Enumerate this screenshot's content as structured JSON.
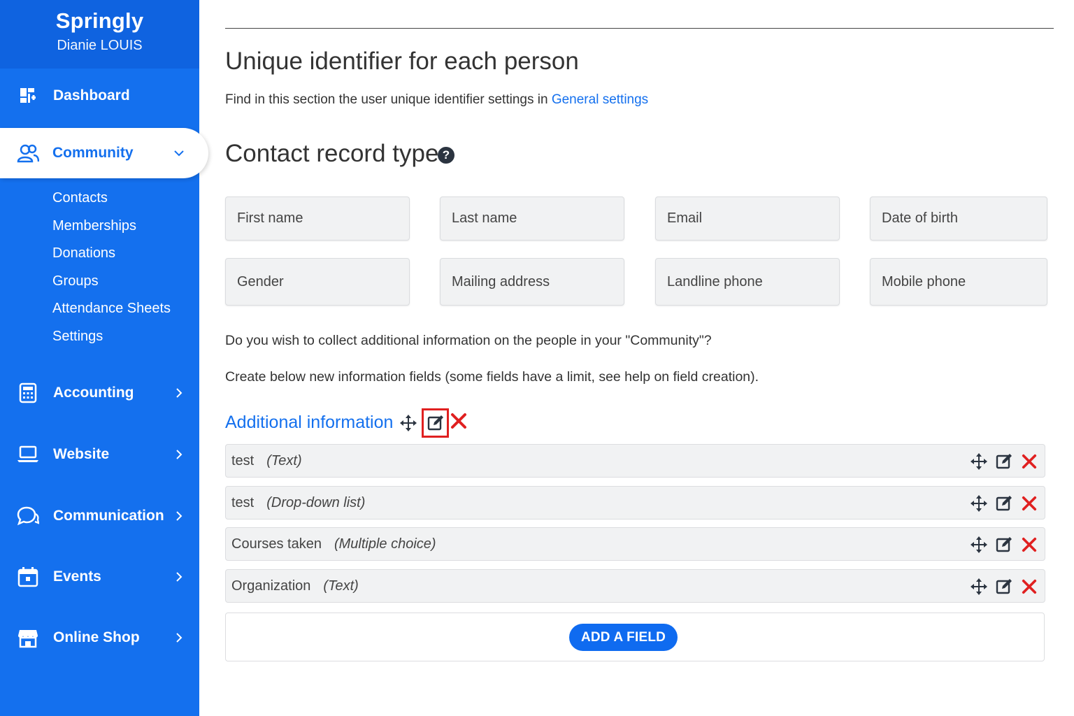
{
  "brand": {
    "name": "Springly",
    "user": "Dianie LOUIS"
  },
  "sidebar": {
    "items": [
      {
        "label": "Dashboard",
        "icon": "dashboard-icon"
      },
      {
        "label": "Community",
        "icon": "community-icon",
        "active": true
      },
      {
        "label": "Accounting",
        "icon": "calculator-icon"
      },
      {
        "label": "Website",
        "icon": "laptop-icon"
      },
      {
        "label": "Communication",
        "icon": "chat-icon"
      },
      {
        "label": "Events",
        "icon": "calendar-icon"
      },
      {
        "label": "Online Shop",
        "icon": "shop-icon"
      }
    ],
    "submenu": [
      "Contacts",
      "Memberships",
      "Donations",
      "Groups",
      "Attendance Sheets",
      "Settings"
    ]
  },
  "main": {
    "uid_title": "Unique identifier for each person",
    "uid_desc_prefix": "Find in this section the user unique identifier settings in ",
    "uid_desc_link": "General settings",
    "contact_title": "Contact record type",
    "help_glyph": "?",
    "standard_fields": [
      "First name",
      "Last name",
      "Email",
      "Date of birth",
      "Gender",
      "Mailing address",
      "Landline phone",
      "Mobile phone"
    ],
    "question": "Do you wish to collect additional information on the people in your \"Community\"?",
    "instruction": "Create below new information fields (some fields have a limit, see help on field creation).",
    "additional_title": "Additional information",
    "custom_fields": [
      {
        "name": "test",
        "type": "(Text)"
      },
      {
        "name": "test",
        "type": "(Drop-down list)"
      },
      {
        "name": "Courses taken",
        "type": "(Multiple choice)"
      },
      {
        "name": "Organization",
        "type": "(Text)"
      }
    ],
    "add_button": "ADD A FIELD"
  },
  "colors": {
    "brand_blue": "#1470ee",
    "delete_red": "#e02020",
    "highlight_red": "#e02020"
  }
}
